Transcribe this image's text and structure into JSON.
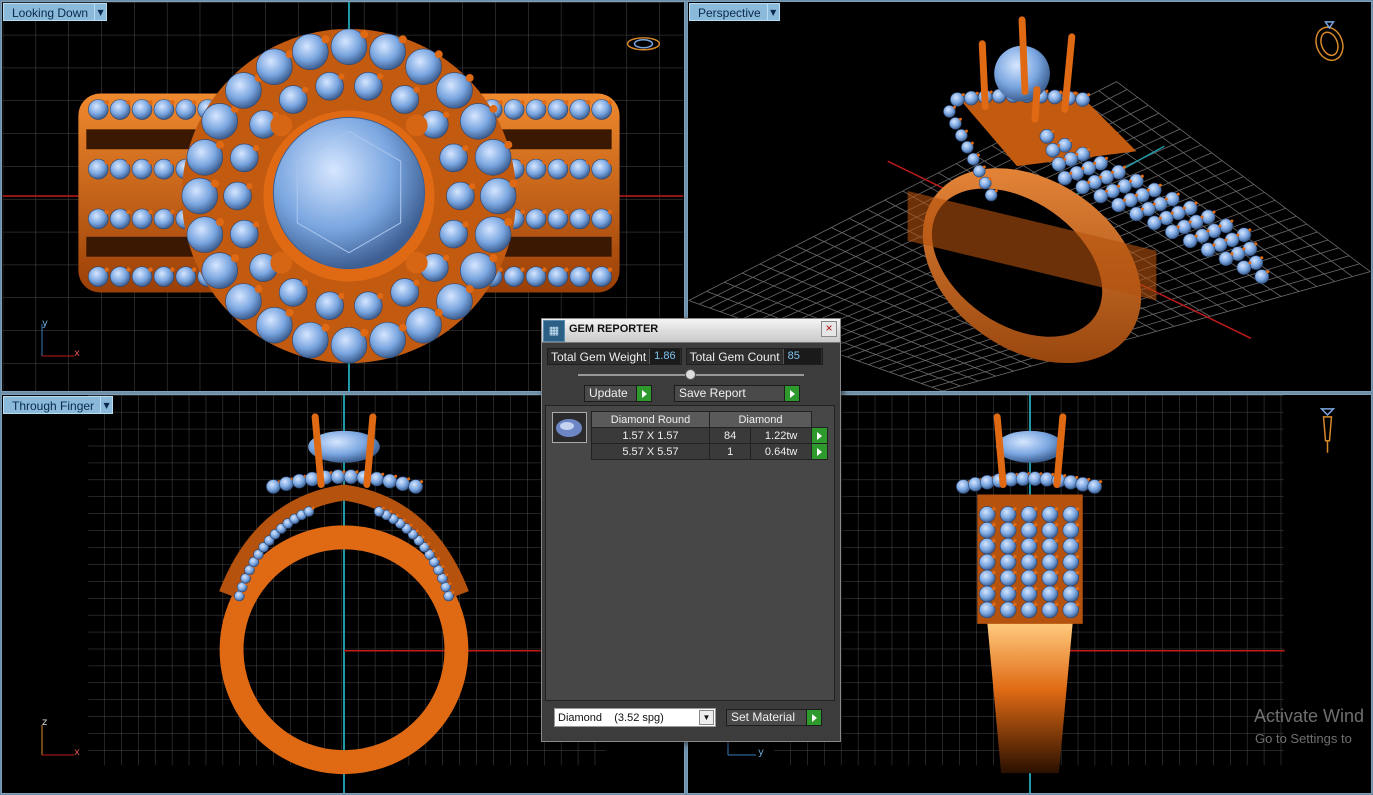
{
  "viewports": {
    "top": {
      "label": "Looking Down",
      "axes": {
        "a": "y",
        "b": "x"
      }
    },
    "perspective": {
      "label": "Perspective"
    },
    "front": {
      "label": "Through Finger",
      "axes": {
        "a": "z",
        "b": "x"
      }
    },
    "side": {
      "axes": {
        "b": "y"
      }
    }
  },
  "gem_reporter": {
    "title": "GEM REPORTER",
    "close_symbol": "×",
    "total_weight_label": "Total Gem Weight",
    "total_weight_value": "1.86",
    "total_count_label": "Total Gem Count",
    "total_count_value": "85",
    "update_label": "Update",
    "save_report_label": "Save Report",
    "table": {
      "headers": [
        "Diamond Round",
        "",
        "Diamond"
      ],
      "rows": [
        {
          "size": "1.57 X 1.57",
          "count": "84",
          "weight": "1.22tw"
        },
        {
          "size": "5.57 X 5.57",
          "count": "1",
          "weight": "0.64tw"
        }
      ]
    },
    "material_select": "Diamond    (3.52 spg)",
    "set_material_label": "Set Material"
  },
  "watermark": {
    "line1": "Activate Wind",
    "line2": "Go to Settings to"
  },
  "colors": {
    "metal": "#e06a14",
    "gem": "#7aa6e0",
    "grid": "#5a5a5a",
    "axis_red": "#c01a1a",
    "axis_cyan": "#1f9aa8",
    "label_bg": "#8ab9da",
    "go_green": "#2e9a2e"
  }
}
